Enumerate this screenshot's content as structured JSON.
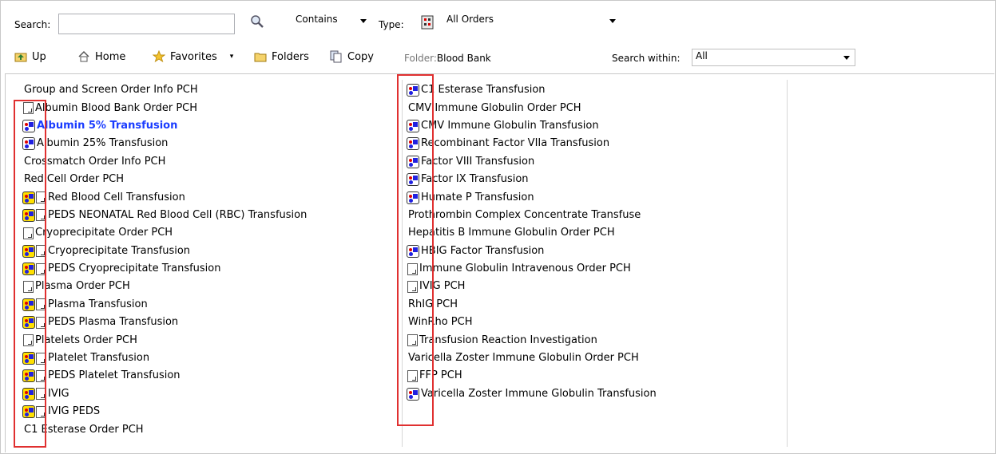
{
  "search": {
    "label": "Search:",
    "value": "",
    "mode": "Contains",
    "type_label": "Type:",
    "type_value": "All Orders",
    "within_label": "Search within:",
    "within_value": "All"
  },
  "toolbar": {
    "up": "Up",
    "home": "Home",
    "favorites": "Favorites",
    "folders": "Folders",
    "copy": "Copy"
  },
  "folder": {
    "label": "Folder:",
    "value": "Blood Bank"
  },
  "col1": [
    {
      "text": "Group and Screen Order Info PCH",
      "icons": []
    },
    {
      "text": "Albumin Blood Bank Order PCH",
      "icons": [
        "doc"
      ]
    },
    {
      "text": "Albumin 5% Transfusion",
      "icons": [
        "tw"
      ],
      "selected": true
    },
    {
      "text": "Albumin 25% Transfusion",
      "icons": [
        "tw"
      ]
    },
    {
      "text": "Crossmatch Order Info PCH",
      "icons": []
    },
    {
      "text": "Red Cell Order PCH",
      "icons": []
    },
    {
      "text": "Red Blood Cell Transfusion",
      "icons": [
        "ty",
        "doc"
      ]
    },
    {
      "text": "PEDS NEONATAL Red Blood Cell (RBC) Transfusion",
      "icons": [
        "ty",
        "doc"
      ]
    },
    {
      "text": "Cryoprecipitate Order PCH",
      "icons": [
        "doc"
      ]
    },
    {
      "text": "Cryoprecipitate Transfusion",
      "icons": [
        "ty",
        "doc"
      ]
    },
    {
      "text": "PEDS Cryoprecipitate Transfusion",
      "icons": [
        "ty",
        "doc"
      ]
    },
    {
      "text": "Plasma Order PCH",
      "icons": [
        "doc"
      ]
    },
    {
      "text": "Plasma Transfusion",
      "icons": [
        "ty",
        "doc"
      ]
    },
    {
      "text": "PEDS Plasma Transfusion",
      "icons": [
        "ty",
        "doc"
      ]
    },
    {
      "text": "Platelets Order PCH",
      "icons": [
        "doc"
      ]
    },
    {
      "text": "Platelet Transfusion",
      "icons": [
        "ty",
        "doc"
      ]
    },
    {
      "text": "PEDS Platelet Transfusion",
      "icons": [
        "ty",
        "doc"
      ]
    },
    {
      "text": "IVIG",
      "icons": [
        "ty",
        "doc"
      ]
    },
    {
      "text": "IVIG PEDS",
      "icons": [
        "ty",
        "doc"
      ]
    },
    {
      "text": "C1 Esterase Order PCH",
      "icons": []
    }
  ],
  "col2": [
    {
      "text": "C1 Esterase Transfusion",
      "icons": [
        "tw"
      ]
    },
    {
      "text": "CMV Immune Globulin Order PCH",
      "icons": []
    },
    {
      "text": "CMV Immune Globulin Transfusion",
      "icons": [
        "tw"
      ]
    },
    {
      "text": "Recombinant Factor VIIa Transfusion",
      "icons": [
        "tw"
      ]
    },
    {
      "text": "Factor VIII Transfusion",
      "icons": [
        "tw"
      ]
    },
    {
      "text": "Factor IX Transfusion",
      "icons": [
        "tw"
      ]
    },
    {
      "text": "Humate P Transfusion",
      "icons": [
        "tw"
      ]
    },
    {
      "text": "Prothrombin Complex Concentrate Transfuse",
      "icons": []
    },
    {
      "text": "Hepatitis B Immune Globulin Order PCH",
      "icons": []
    },
    {
      "text": "HBIG Factor Transfusion",
      "icons": [
        "tw"
      ]
    },
    {
      "text": "Immune Globulin Intravenous Order PCH",
      "icons": [
        "doc"
      ]
    },
    {
      "text": "IVIG PCH",
      "icons": [
        "doc"
      ]
    },
    {
      "text": "RhIG PCH",
      "icons": []
    },
    {
      "text": "WinRho PCH",
      "icons": []
    },
    {
      "text": "Transfusion Reaction Investigation",
      "icons": [
        "doc"
      ]
    },
    {
      "text": "Varicella Zoster Immune Globulin Order PCH",
      "icons": []
    },
    {
      "text": "FFP PCH",
      "icons": [
        "doc"
      ]
    },
    {
      "text": "Varicella Zoster Immune Globulin Transfusion",
      "icons": [
        "tw"
      ]
    }
  ]
}
